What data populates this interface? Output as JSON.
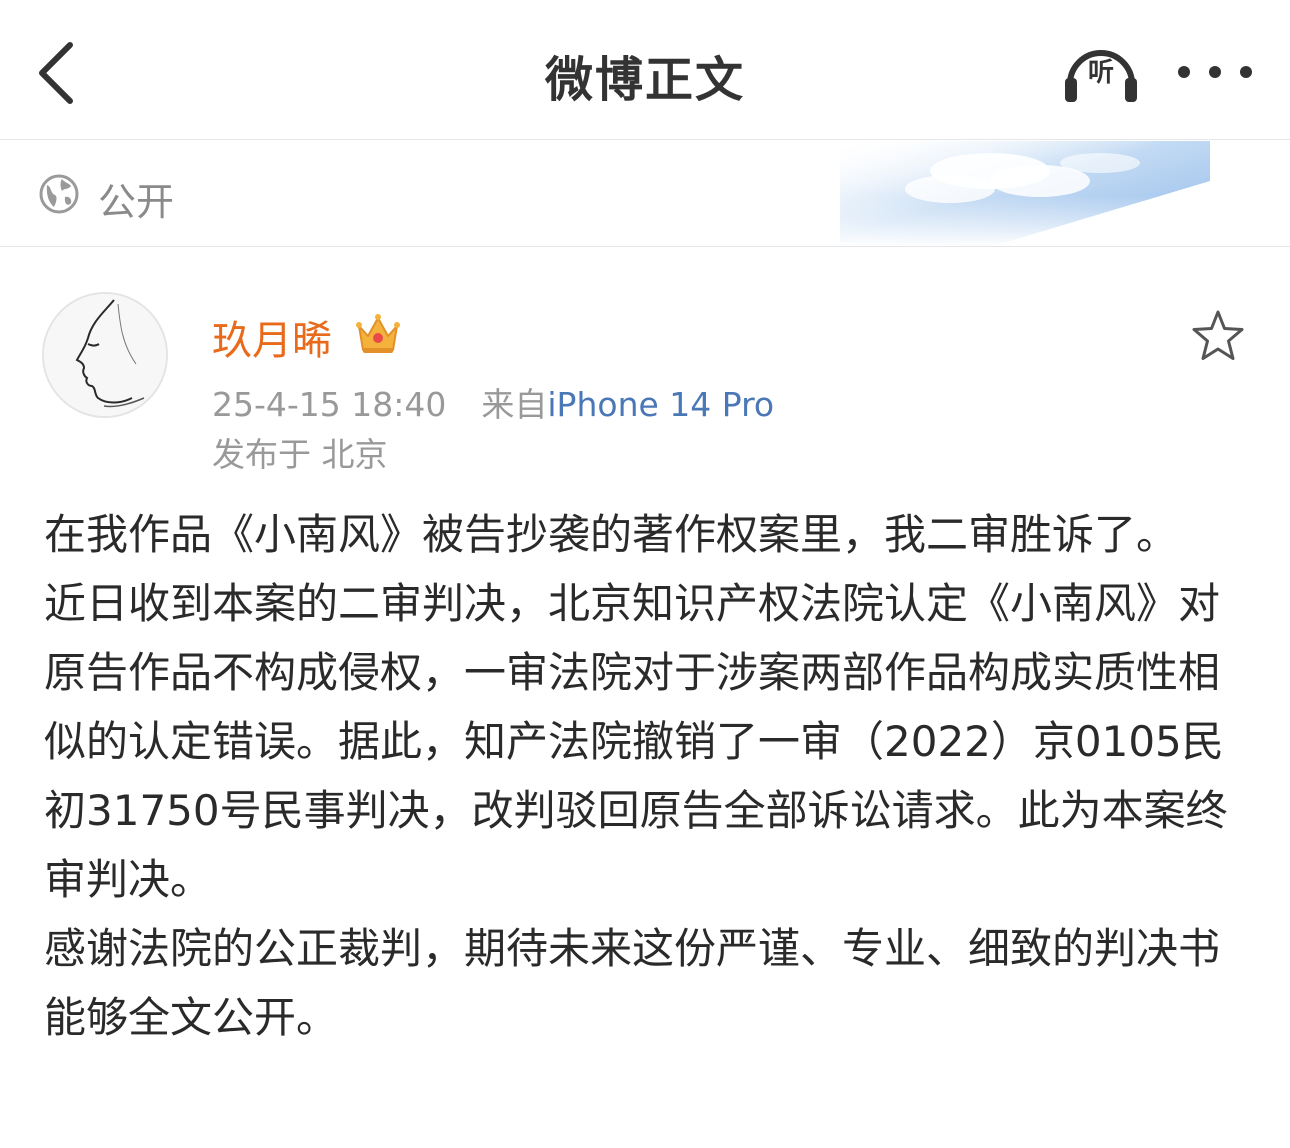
{
  "nav": {
    "title": "微博正文",
    "listen_label": "听",
    "back_icon": "chevron-left-icon",
    "more_icon": "more-dots-icon"
  },
  "visibility": {
    "icon": "globe-icon",
    "label": "公开"
  },
  "post": {
    "author": "玖月晞",
    "badge_icon": "crown-icon",
    "timestamp": "25-4-15 18:40",
    "source_prefix": "来自",
    "source_device": "iPhone 14 Pro",
    "location": "发布于 北京",
    "paragraphs": [
      "在我作品《小南风》被告抄袭的著作权案里，我二审胜诉了。",
      "近日收到本案的二审判决，北京知识产权法院认定《小南风》对原告作品不构成侵权，一审法院对于涉案两部作品构成实质性相似的认定错误。据此，知产法院撤销了一审（2022）京0105民初31750号民事判决，改判驳回原告全部诉讼请求。此为本案终审判决。",
      "感谢法院的公正裁判，期待未来这份严谨、专业、细致的判决书能够全文公开。"
    ]
  },
  "colors": {
    "username": "#e86b1c",
    "link": "#4a77b6",
    "meta": "#999999"
  }
}
